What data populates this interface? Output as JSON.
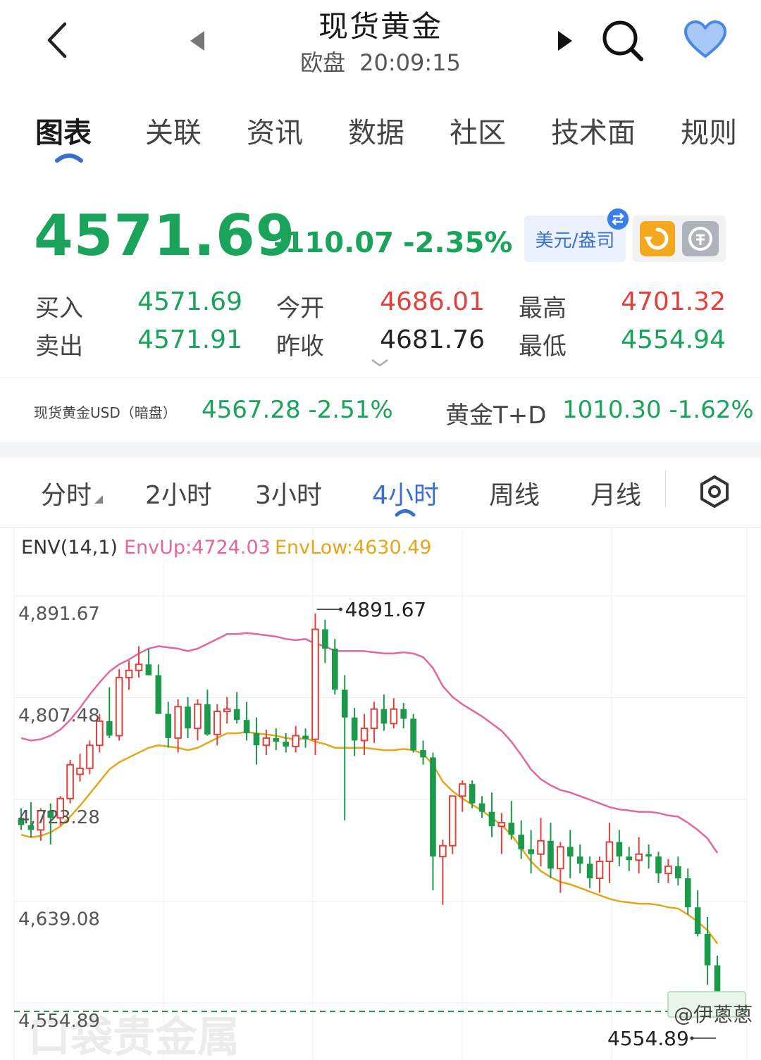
{
  "header": {
    "title": "现货黄金",
    "session": "欧盘",
    "time": "20:09:15"
  },
  "tabs": [
    "图表",
    "关联",
    "资讯",
    "数据",
    "社区",
    "技术面",
    "规则"
  ],
  "quote": {
    "price": "4571.69",
    "change": "-110.07",
    "change_pct": "-2.35%",
    "unit": "美元/盎司",
    "rows": [
      {
        "label": "买入",
        "value": "4571.69",
        "color": "green"
      },
      {
        "label": "今开",
        "value": "4686.01",
        "color": "red"
      },
      {
        "label": "最高",
        "value": "4701.32",
        "color": "red"
      },
      {
        "label": "卖出",
        "value": "4571.91",
        "color": "green"
      },
      {
        "label": "昨收",
        "value": "4681.76",
        "color": "dark"
      },
      {
        "label": "最低",
        "value": "4554.94",
        "color": "green"
      }
    ]
  },
  "related": {
    "left_label": "现货黄金USD（暗盘）",
    "left_value": "4567.28 -2.51%",
    "right_label": "黄金T+D",
    "right_value": "1010.30 -1.62%"
  },
  "periods": [
    "分时",
    "2小时",
    "3小时",
    "4小时",
    "周线",
    "月线"
  ],
  "active_period": "4小时",
  "indicator": {
    "name": "ENV(14,1)",
    "up_label": "EnvUp:4724.03",
    "low_label": "EnvLow:4630.49"
  },
  "colors": {
    "up": "#e2413b",
    "down": "#1a9a4a",
    "env_up": "#e067a0",
    "env_low": "#e6a619",
    "accent": "#3a6fcf"
  },
  "chart_data": {
    "type": "candlestick",
    "y_ticks": [
      "4,891.67",
      "4,807.48",
      "4,723.28",
      "4,639.08",
      "4,554.89"
    ],
    "ylim": [
      4554.89,
      4891.67
    ],
    "max_label": "4891.67",
    "min_label": "4554.89",
    "last_price_line": 4554.89,
    "candles": [
      [
        4722,
        4730,
        4712,
        4716
      ],
      [
        4716,
        4735,
        4706,
        4712
      ],
      [
        4712,
        4730,
        4703,
        4728
      ],
      [
        4728,
        4734,
        4700,
        4722
      ],
      [
        4722,
        4740,
        4716,
        4738
      ],
      [
        4738,
        4770,
        4734,
        4766
      ],
      [
        4758,
        4775,
        4752,
        4763
      ],
      [
        4763,
        4786,
        4758,
        4782
      ],
      [
        4782,
        4808,
        4776,
        4802
      ],
      [
        4802,
        4830,
        4788,
        4790
      ],
      [
        4790,
        4845,
        4786,
        4838
      ],
      [
        4838,
        4852,
        4828,
        4844
      ],
      [
        4844,
        4864,
        4838,
        4849
      ],
      [
        4849,
        4862,
        4840,
        4840
      ],
      [
        4840,
        4849,
        4808,
        4808
      ],
      [
        4808,
        4818,
        4780,
        4788
      ],
      [
        4788,
        4820,
        4776,
        4814
      ],
      [
        4814,
        4822,
        4788,
        4796
      ],
      [
        4796,
        4820,
        4786,
        4816
      ],
      [
        4816,
        4828,
        4790,
        4791
      ],
      [
        4791,
        4816,
        4782,
        4810
      ],
      [
        4810,
        4822,
        4800,
        4812
      ],
      [
        4812,
        4826,
        4800,
        4803
      ],
      [
        4803,
        4818,
        4786,
        4792
      ],
      [
        4792,
        4805,
        4766,
        4782
      ],
      [
        4782,
        4795,
        4774,
        4788
      ],
      [
        4788,
        4796,
        4778,
        4785
      ],
      [
        4785,
        4792,
        4776,
        4781
      ],
      [
        4781,
        4798,
        4776,
        4790
      ],
      [
        4790,
        4796,
        4780,
        4787
      ],
      [
        4787,
        4891,
        4774,
        4878
      ],
      [
        4878,
        4886,
        4850,
        4862
      ],
      [
        4862,
        4870,
        4824,
        4828
      ],
      [
        4828,
        4840,
        4720,
        4805
      ],
      [
        4805,
        4813,
        4773,
        4786
      ],
      [
        4786,
        4808,
        4774,
        4796
      ],
      [
        4796,
        4818,
        4784,
        4812
      ],
      [
        4812,
        4824,
        4794,
        4800
      ],
      [
        4800,
        4821,
        4796,
        4812
      ],
      [
        4812,
        4817,
        4796,
        4804
      ],
      [
        4804,
        4808,
        4776,
        4778
      ],
      [
        4778,
        4786,
        4766,
        4772
      ],
      [
        4772,
        4776,
        4662,
        4690
      ],
      [
        4690,
        4704,
        4650,
        4699
      ],
      [
        4699,
        4740,
        4692,
        4740
      ],
      [
        4740,
        4753,
        4727,
        4750
      ],
      [
        4750,
        4753,
        4730,
        4734
      ],
      [
        4734,
        4740,
        4722,
        4727
      ],
      [
        4727,
        4743,
        4706,
        4715
      ],
      [
        4715,
        4726,
        4692,
        4718
      ],
      [
        4718,
        4736,
        4704,
        4708
      ],
      [
        4708,
        4720,
        4688,
        4696
      ],
      [
        4696,
        4712,
        4676,
        4692
      ],
      [
        4692,
        4722,
        4682,
        4703
      ],
      [
        4703,
        4718,
        4672,
        4680
      ],
      [
        4680,
        4702,
        4660,
        4698
      ],
      [
        4698,
        4712,
        4672,
        4690
      ],
      [
        4690,
        4700,
        4676,
        4684
      ],
      [
        4684,
        4690,
        4664,
        4672
      ],
      [
        4672,
        4690,
        4660,
        4686
      ],
      [
        4686,
        4718,
        4668,
        4702
      ],
      [
        4702,
        4712,
        4682,
        4690
      ],
      [
        4690,
        4698,
        4678,
        4687
      ],
      [
        4687,
        4706,
        4676,
        4692
      ],
      [
        4692,
        4700,
        4680,
        4690
      ],
      [
        4690,
        4694,
        4668,
        4676
      ],
      [
        4676,
        4688,
        4668,
        4682
      ],
      [
        4682,
        4690,
        4666,
        4672
      ],
      [
        4672,
        4680,
        4642,
        4648
      ],
      [
        4648,
        4662,
        4624,
        4626
      ],
      [
        4626,
        4640,
        4584,
        4600
      ],
      [
        4600,
        4608,
        4554,
        4572
      ]
    ],
    "env_up": [
      4788,
      4786,
      4787,
      4790,
      4795,
      4803,
      4813,
      4824,
      4834,
      4843,
      4849,
      4853,
      4858,
      4862,
      4864,
      4863,
      4862,
      4860,
      4862,
      4866,
      4870,
      4874,
      4874,
      4875,
      4874,
      4873,
      4872,
      4870,
      4869,
      4870,
      4866,
      4864,
      4860,
      4860,
      4860,
      4860,
      4859,
      4858,
      4858,
      4859,
      4858,
      4855,
      4846,
      4831,
      4822,
      4816,
      4811,
      4806,
      4800,
      4794,
      4785,
      4774,
      4762,
      4754,
      4749,
      4745,
      4743,
      4740,
      4737,
      4734,
      4731,
      4729,
      4728,
      4727,
      4727,
      4726,
      4724,
      4723,
      4718,
      4712,
      4705,
      4693
    ],
    "env_low": [
      4708,
      4706,
      4707,
      4710,
      4715,
      4723,
      4732,
      4742,
      4752,
      4762,
      4768,
      4772,
      4776,
      4780,
      4782,
      4781,
      4780,
      4778,
      4780,
      4784,
      4788,
      4792,
      4792,
      4793,
      4792,
      4791,
      4790,
      4788,
      4787,
      4788,
      4785,
      4783,
      4780,
      4780,
      4780,
      4780,
      4779,
      4778,
      4778,
      4779,
      4778,
      4775,
      4766,
      4752,
      4744,
      4738,
      4733,
      4728,
      4722,
      4716,
      4708,
      4697,
      4686,
      4678,
      4673,
      4669,
      4667,
      4664,
      4661,
      4658,
      4655,
      4653,
      4652,
      4651,
      4651,
      4650,
      4648,
      4647,
      4642,
      4636,
      4629,
      4618
    ]
  },
  "watermark": "口袋贵金属",
  "credit": "@伊蔥蔥"
}
